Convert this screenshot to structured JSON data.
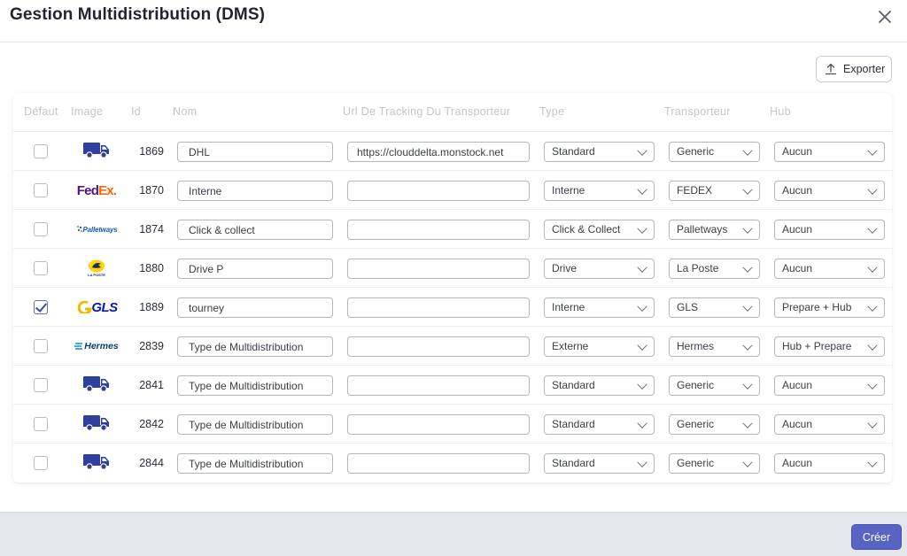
{
  "dialog": {
    "title": "Gestion Multidistribution (DMS)",
    "close_icon": "close-icon"
  },
  "toolbar": {
    "export_label": "Exporter",
    "export_icon": "upload-icon"
  },
  "table": {
    "headers": {
      "default": "Défaut",
      "image": "Image",
      "id": "Id",
      "nom": "Nom",
      "url": "Url De Tracking Du Transporteur",
      "type": "Type",
      "transporteur": "Transporteur",
      "hub": "Hub"
    },
    "rows": [
      {
        "checked": false,
        "logo": "truck-icon",
        "id": "1869",
        "nom": "DHL",
        "url": "https://clouddelta.monstock.net",
        "type": "Standard",
        "transporteur": "Generic",
        "hub": "Aucun"
      },
      {
        "checked": false,
        "logo": "fedex-logo",
        "id": "1870",
        "nom": "Interne",
        "url": "",
        "type": "Interne",
        "transporteur": "FEDEX",
        "hub": "Aucun"
      },
      {
        "checked": false,
        "logo": "palletways-logo",
        "id": "1874",
        "nom": "Click & collect",
        "url": "",
        "type": "Click & Collect",
        "transporteur": "Palletways",
        "hub": "Aucun"
      },
      {
        "checked": false,
        "logo": "la-poste-logo",
        "id": "1880",
        "nom": "Drive P",
        "url": "",
        "type": "Drive",
        "transporteur": "La Poste",
        "hub": "Aucun"
      },
      {
        "checked": true,
        "logo": "gls-logo",
        "id": "1889",
        "nom": "tourney",
        "url": "",
        "type": "Interne",
        "transporteur": "GLS",
        "hub": "Prepare + Hub"
      },
      {
        "checked": false,
        "logo": "hermes-logo",
        "id": "2839",
        "nom": "Type de Multidistribution",
        "url": "",
        "type": "Externe",
        "transporteur": "Hermes",
        "hub": "Hub + Prepare"
      },
      {
        "checked": false,
        "logo": "truck-icon",
        "id": "2841",
        "nom": "Type de Multidistribution",
        "url": "",
        "type": "Standard",
        "transporteur": "Generic",
        "hub": "Aucun"
      },
      {
        "checked": false,
        "logo": "truck-icon",
        "id": "2842",
        "nom": "Type de Multidistribution",
        "url": "",
        "type": "Standard",
        "transporteur": "Generic",
        "hub": "Aucun"
      },
      {
        "checked": false,
        "logo": "truck-icon",
        "id": "2844",
        "nom": "Type de Multidistribution",
        "url": "",
        "type": "Standard",
        "transporteur": "Generic",
        "hub": "Aucun"
      }
    ]
  },
  "logos": {
    "fedex": {
      "fed": "Fed",
      "ex": "Ex",
      "dot": "."
    },
    "palletways": "Palletways",
    "la_poste": "LA POSTE",
    "gls": "GLS",
    "hermes": "Hermes"
  },
  "footer": {
    "create_label": "Créer"
  },
  "colors": {
    "accent": "#5764c4",
    "truck": "#2f3f9e",
    "fedex_purple": "#4d148c",
    "fedex_orange": "#ff6600",
    "gls_blue": "#061ab1",
    "gls_yellow": "#f5b800",
    "laposte_yellow": "#ffd400"
  }
}
